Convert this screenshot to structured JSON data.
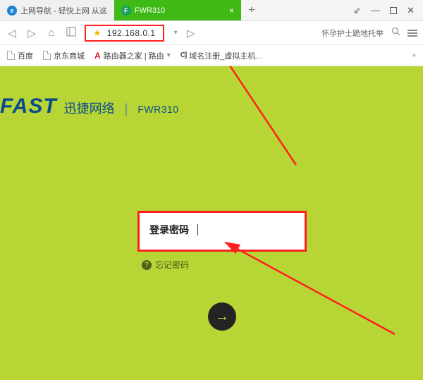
{
  "titlebar": {
    "tab_inactive": "上网导航 - 轻快上网 从这",
    "tab_active": "FWR310",
    "newtab": "+"
  },
  "window": {
    "pin": "⇙",
    "min": "—",
    "max": "",
    "close": "✕"
  },
  "nav": {
    "back": "◁",
    "forward": "▷",
    "home": "⌂"
  },
  "address": {
    "url": "192.168.0.1",
    "right_text": "怀孕护士跪地托举"
  },
  "bookmarks": {
    "b1": "百度",
    "b2": "京东商城",
    "b3": "路由器之家 | 路由",
    "b4": "域名注册_虚拟主机…"
  },
  "brand": {
    "logo": "FAST",
    "cn": "迅捷网络",
    "sep": "|",
    "model": "FWR310"
  },
  "login": {
    "label": "登录密码",
    "forgot": "忘记密码"
  },
  "go": "→"
}
